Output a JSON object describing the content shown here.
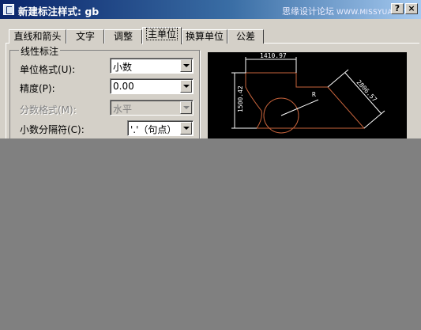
{
  "window": {
    "title": "新建标注样式: gb",
    "watermark": "思缘设计论坛",
    "watermark_url": "WWW.MISSYUAN.COM",
    "help_label": "?",
    "close_label": "×"
  },
  "tabs": [
    {
      "label": "直线和箭头",
      "active": false
    },
    {
      "label": "文字",
      "active": false
    },
    {
      "label": "调整",
      "active": false
    },
    {
      "label": "主单位",
      "active": true
    },
    {
      "label": "换算单位",
      "active": false
    },
    {
      "label": "公差",
      "active": false
    }
  ],
  "linear": {
    "group_title": "线性标注",
    "unit_format": {
      "label": "单位格式(U):",
      "value": "小数"
    },
    "precision": {
      "label": "精度(P):",
      "value": "0.00"
    },
    "fraction_format": {
      "label": "分数格式(M):",
      "value": "水平"
    },
    "decimal_separator": {
      "label": "小数分隔符(C):",
      "value": "'.'（句点）"
    }
  },
  "preview": {
    "dims": [
      "1410.97",
      "1500.42",
      "2806.57",
      "R"
    ]
  },
  "colors": {
    "dialog_bg": "#d4d0c8",
    "title_start": "#0a246a",
    "preview_bg": "#000000",
    "outline_color": "#c8643c",
    "dim_color": "#ffffff"
  }
}
